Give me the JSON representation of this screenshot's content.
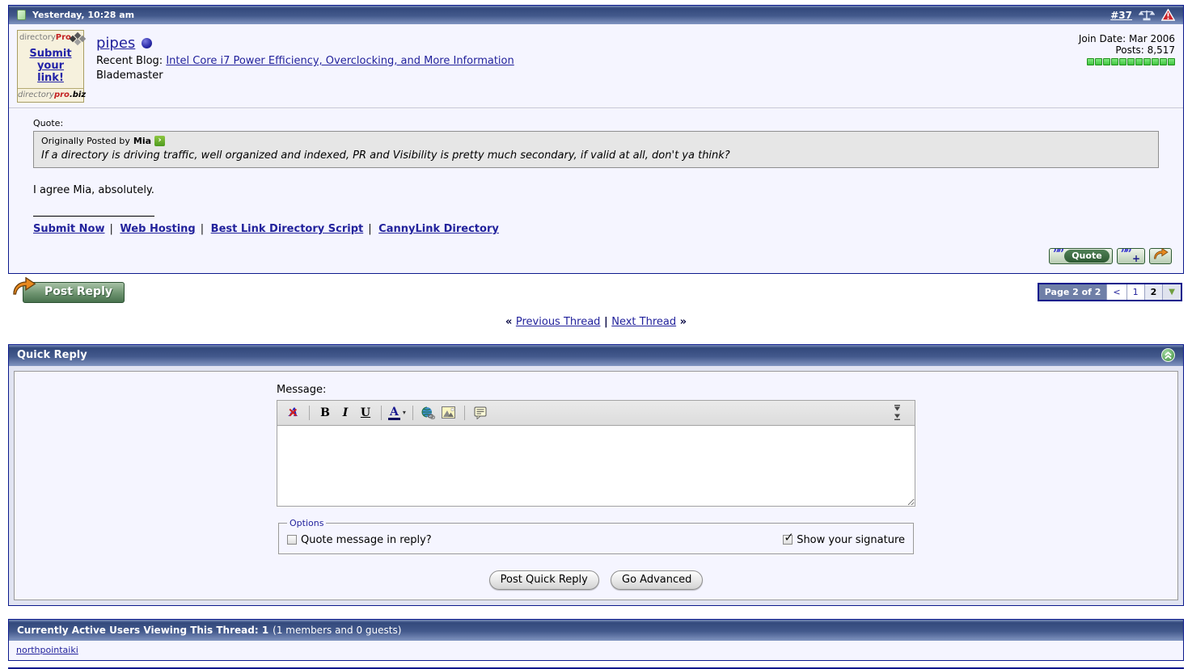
{
  "post": {
    "datebar": {
      "date": "Yesterday, 10:28 am",
      "post_number": "#37"
    },
    "user": {
      "username": "pipes",
      "recent_blog_label": "Recent Blog:",
      "recent_blog_link": "Intel Core i7 Power Efficiency, Overclocking, and More Information",
      "user_title": "Blademaster",
      "join_date": "Join Date: Mar 2006",
      "posts": "Posts: 8,517",
      "avatar": {
        "brand_gray": "directory",
        "brand_red": "Pro",
        "cta": "Submit your link!",
        "domain_gray": "directory",
        "domain_red": "pro",
        "domain_suffix": ".biz"
      }
    },
    "content": {
      "quote_label": "Quote:",
      "quote_header_prefix": "Originally Posted by",
      "quote_author": "Mia",
      "quote_text": "If a directory is driving traffic, well organized and indexed, PR and Visibility is pretty much secondary, if valid at all, don't ya think?",
      "reply_text": "I agree Mia, absolutely.",
      "signature_links": [
        "Submit Now",
        "Web Hosting",
        "Best Link Directory Script",
        "CannyLink Directory"
      ],
      "sig_separator": "|"
    },
    "controls": {
      "quote_button": "Quote"
    }
  },
  "toolbar_row": {
    "post_reply": "Post Reply",
    "pagination": {
      "label": "Page 2 of 2",
      "prev": "<",
      "page1": "1",
      "page2": "2",
      "dropdown_arrow": "▼"
    }
  },
  "thread_nav": {
    "laquo": "«",
    "prev": "Previous Thread",
    "sep": "|",
    "next": "Next Thread",
    "raquo": "»"
  },
  "quick_reply": {
    "title": "Quick Reply",
    "message_label": "Message:",
    "toolbar": {
      "remove_format": "A",
      "bold": "B",
      "italic": "I",
      "underline": "U",
      "color": "A",
      "dropdown": "▾"
    },
    "options_legend": "Options",
    "option_quote": "Quote message in reply?",
    "option_signature": "Show your signature",
    "post_button": "Post Quick Reply",
    "advanced_button": "Go Advanced"
  },
  "active_users": {
    "title_bold": "Currently Active Users Viewing This Thread: 1",
    "title_rest": "(1 members and 0 guests)",
    "user": "northpointaiki"
  },
  "glyphs": {
    "check": "✓",
    "qmarks": "””",
    "plus": "+",
    "rf_x": "✕",
    "viewpost_arrow": "›"
  },
  "colors": {
    "link": "#22229c",
    "panel-border": "#0b198c",
    "content-bg": "#f5f5ff",
    "pad-bg": "#e1e4f2",
    "head-top": "#33497c",
    "head-bottom": "#8094c0",
    "rep-green": "#41c641",
    "report-red": "#cc2229",
    "arrow-orange": "#e8891e",
    "btn-green": "#2e5a33"
  }
}
